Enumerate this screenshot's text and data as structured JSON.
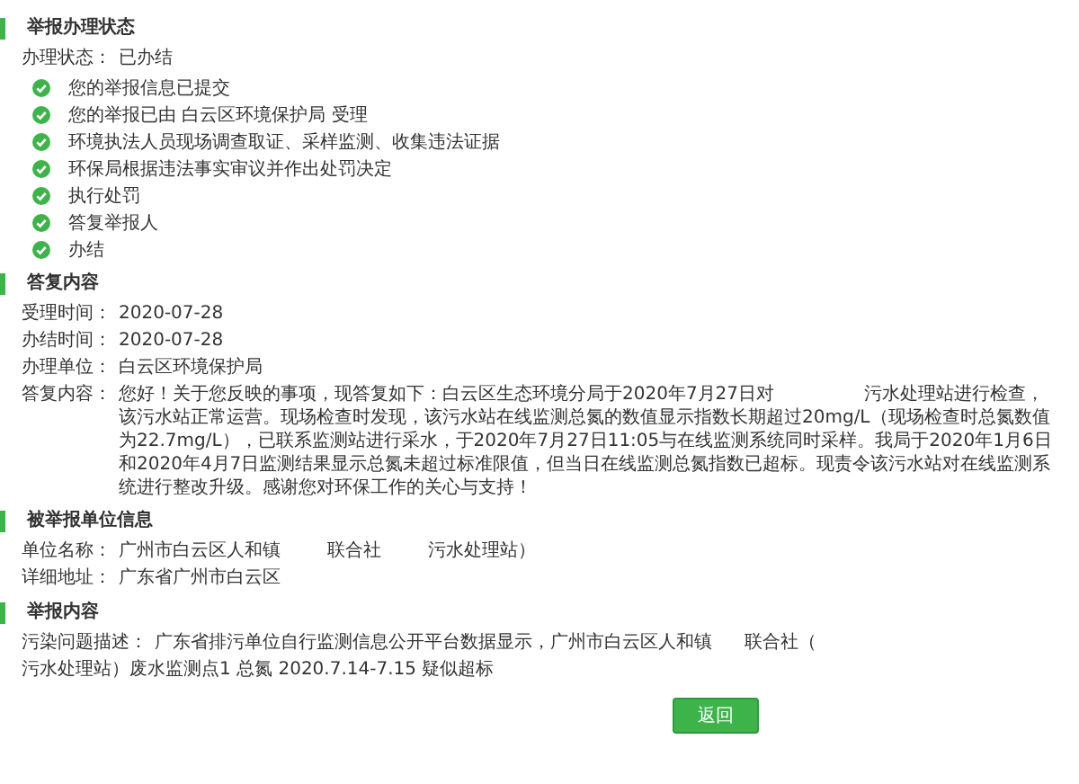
{
  "status_section": {
    "title": "举报办理状态",
    "status_label": "办理状态：",
    "status_value": "已办结",
    "steps": [
      {
        "text": "您的举报信息已提交",
        "done": true
      },
      {
        "text": "您的举报已由 白云区环境保护局 受理",
        "done": true
      },
      {
        "text": "环境执法人员现场调查取证、采样监测、收集违法证据",
        "done": true
      },
      {
        "text": "环保局根据违法事实审议并作出处罚决定",
        "done": true
      },
      {
        "text": "执行处罚",
        "done": true
      },
      {
        "text": "答复举报人",
        "done": true
      },
      {
        "text": "办结",
        "done": true
      }
    ]
  },
  "reply_section": {
    "title": "答复内容",
    "fields": [
      {
        "label": "受理时间：",
        "value": "2020-07-28"
      },
      {
        "label": "办结时间：",
        "value": "2020-07-28"
      },
      {
        "label": "办理单位：",
        "value": "白云区环境保护局"
      }
    ],
    "answer_label": "答复内容：",
    "answer_parts": [
      "您好！关于您反映的事项，现答复如下：白云区生态环境分局于2020年7月27日对",
      "污水处理站进行检查，该污水站正常运营。现场检查时发现，该污水站在线监测总氮的数值显示指数长期超过20mg/L（现场检查时总氮数值为22.7mg/L），已联系监测站进行采水，于2020年7月27日11:05与在线监测系统同时采样。我局于2020年1月6日和2020年4月7日监测结果显示总氮未超过标准限值，但当日在线监测总氮指数已超标。现责令该污水站对在线监测系统进行整改升级。感谢您对环保工作的关心与支持！"
    ]
  },
  "unit_section": {
    "title": "被举报单位信息",
    "name_label": "单位名称：",
    "name_parts": [
      "广州市白云区人和镇",
      "联合社",
      "污水处理站）"
    ],
    "address_label": "详细地址：",
    "address": "广东省广州市白云区"
  },
  "report_section": {
    "title": "举报内容",
    "desc_label": "污染问题描述：",
    "desc_parts": [
      "广东省排污单位自行监测信息公开平台数据显示，广州市白云区人和镇",
      "联合社（",
      "污水处理站）废水监测点1 总氮 2020.7.14-7.15 疑似超标"
    ]
  },
  "back_button": "返回"
}
